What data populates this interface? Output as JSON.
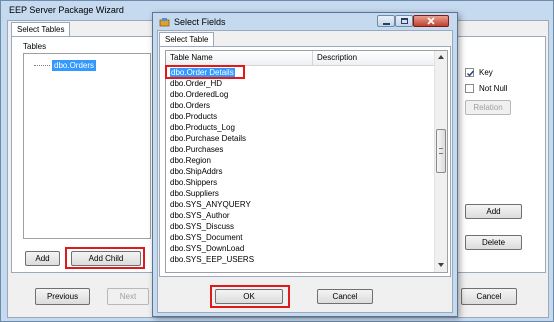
{
  "main_window": {
    "title": "EEP Server Package Wizard",
    "tab": "Select Tables",
    "group_label": "Tables",
    "tree_item": "dbo.Orders",
    "add_label": "Add",
    "add_child_label": "Add Child",
    "previous_label": "Previous",
    "next_label": "Next",
    "cancel_label": "Cancel"
  },
  "right_panel": {
    "key_label": "Key",
    "key_checked": true,
    "not_null_label": "Not Null",
    "not_null_checked": false,
    "relation_label": "Relation",
    "add_label": "Add",
    "delete_label": "Delete"
  },
  "dialog": {
    "title": "Select Fields",
    "tab": "Select Table",
    "columns": [
      "Table Name",
      "Description"
    ],
    "rows": [
      "dbo.Order Details",
      "dbo.Order_HD",
      "dbo.OrderedLog",
      "dbo.Orders",
      "dbo.Products",
      "dbo.Products_Log",
      "dbo.Purchase Details",
      "dbo.Purchases",
      "dbo.Region",
      "dbo.ShipAddrs",
      "dbo.Shippers",
      "dbo.Suppliers",
      "dbo.SYS_ANYQUERY",
      "dbo.SYS_Author",
      "dbo.SYS_Discuss",
      "dbo.SYS_Document",
      "dbo.SYS_DownLoad",
      "dbo.SYS_EEP_USERS"
    ],
    "selected_row": 0,
    "ok_label": "OK",
    "cancel_label": "Cancel"
  }
}
